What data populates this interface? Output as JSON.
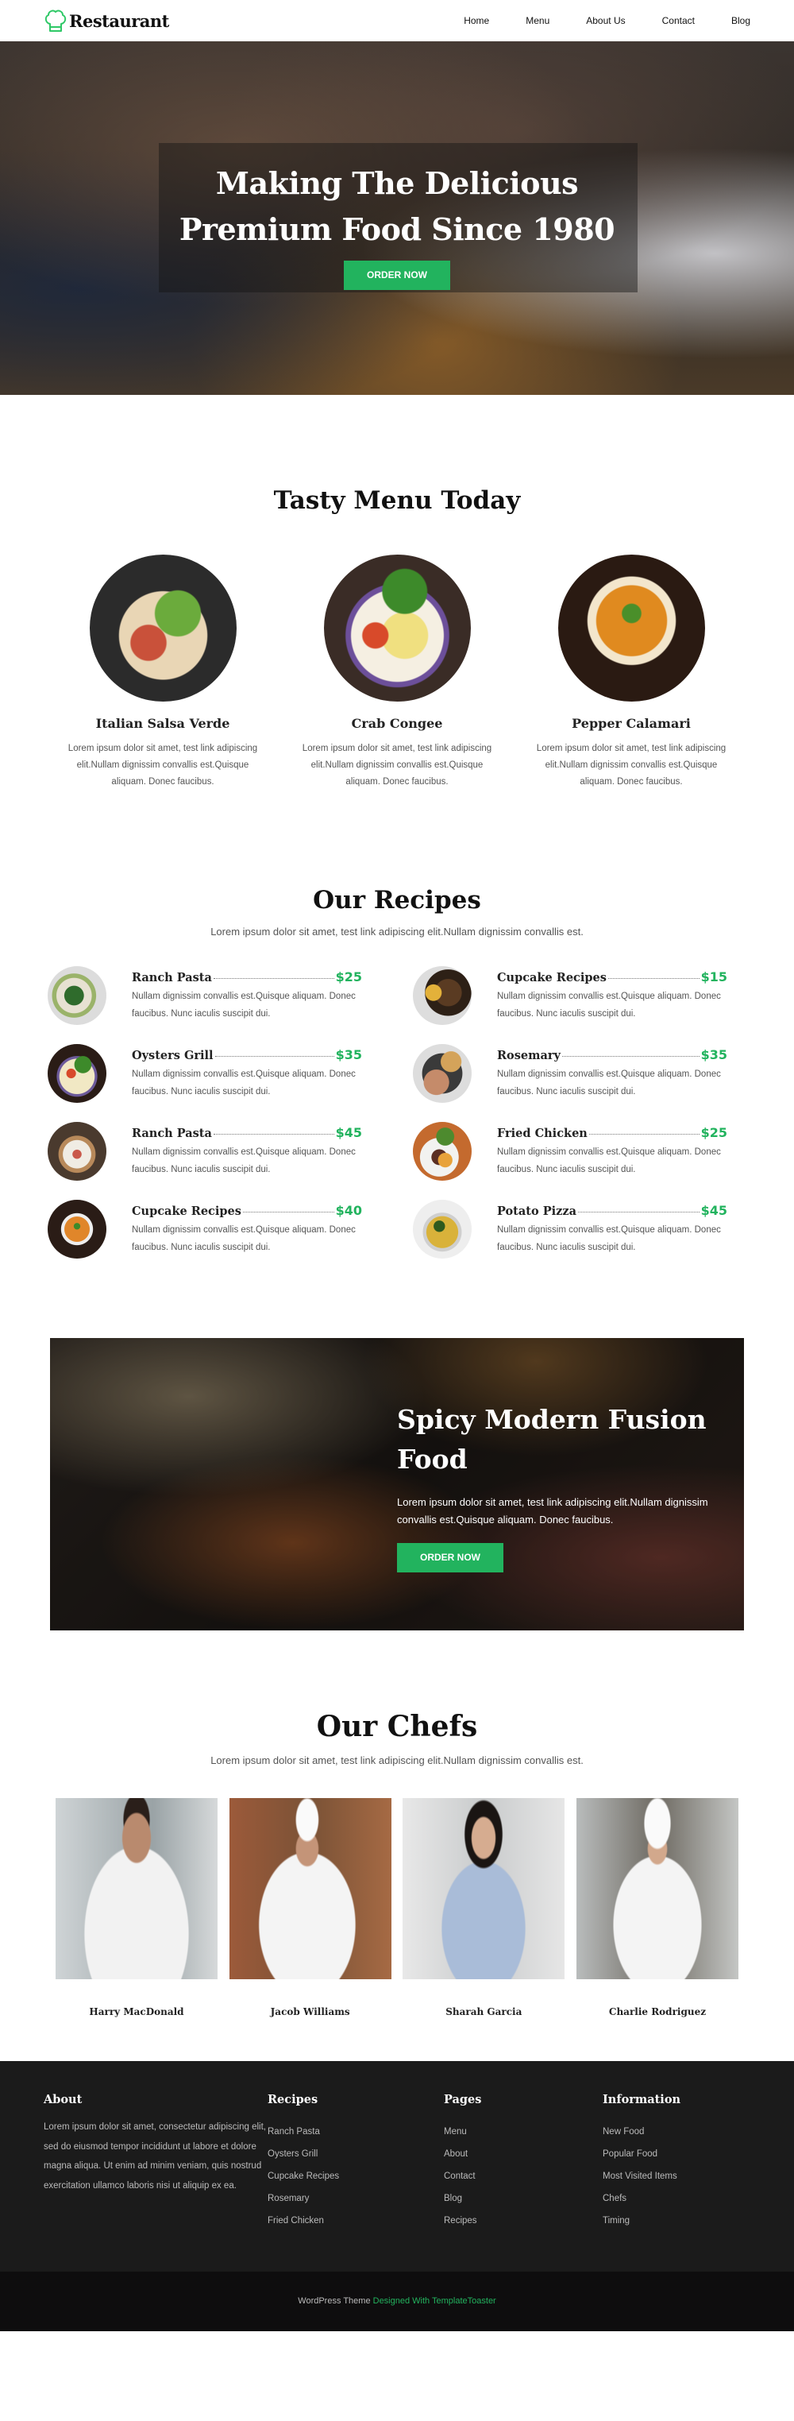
{
  "header": {
    "logo_text": "Restaurant",
    "logo_icon": "chef-hat-icon",
    "nav": [
      "Home",
      "Menu",
      "About Us",
      "Contact",
      "Blog"
    ]
  },
  "hero": {
    "title_line1": "Making The Delicious",
    "title_line2": "Premium Food Since 1980",
    "button": "ORDER NOW"
  },
  "tasty_menu": {
    "title": "Tasty Menu Today",
    "items": [
      {
        "name": "Italian Salsa Verde",
        "desc": "Lorem ipsum dolor sit amet, test link adipiscing elit.Nullam dignissim convallis est.Quisque aliquam. Donec faucibus."
      },
      {
        "name": "Crab Congee",
        "desc": "Lorem ipsum dolor sit amet, test link adipiscing elit.Nullam dignissim convallis est.Quisque aliquam. Donec faucibus."
      },
      {
        "name": "Pepper Calamari",
        "desc": "Lorem ipsum dolor sit amet, test link adipiscing elit.Nullam dignissim convallis est.Quisque aliquam. Donec faucibus."
      }
    ]
  },
  "recipes": {
    "title": "Our Recipes",
    "subtitle": "Lorem ipsum dolor sit amet, test link adipiscing elit.Nullam dignissim convallis est.",
    "items": [
      {
        "name": "Ranch Pasta",
        "price": "$25",
        "desc": "Nullam dignissim convallis est.Quisque aliquam. Donec faucibus. Nunc iaculis suscipit dui."
      },
      {
        "name": "Cupcake Recipes",
        "price": "$15",
        "desc": "Nullam dignissim convallis est.Quisque aliquam. Donec faucibus. Nunc iaculis suscipit dui."
      },
      {
        "name": "Oysters Grill",
        "price": "$35",
        "desc": "Nullam dignissim convallis est.Quisque aliquam. Donec faucibus. Nunc iaculis suscipit dui."
      },
      {
        "name": "Rosemary",
        "price": "$35",
        "desc": "Nullam dignissim convallis est.Quisque aliquam. Donec faucibus. Nunc iaculis suscipit dui."
      },
      {
        "name": "Ranch Pasta",
        "price": "$45",
        "desc": "Nullam dignissim convallis est.Quisque aliquam. Donec faucibus. Nunc iaculis suscipit dui."
      },
      {
        "name": "Fried Chicken",
        "price": "$25",
        "desc": "Nullam dignissim convallis est.Quisque aliquam. Donec faucibus. Nunc iaculis suscipit dui."
      },
      {
        "name": "Cupcake Recipes",
        "price": "$40",
        "desc": "Nullam dignissim convallis est.Quisque aliquam. Donec faucibus. Nunc iaculis suscipit dui."
      },
      {
        "name": "Potato Pizza",
        "price": "$45",
        "desc": "Nullam dignissim convallis est.Quisque aliquam. Donec faucibus. Nunc iaculis suscipit dui."
      }
    ]
  },
  "banner": {
    "title": "Spicy Modern Fusion Food",
    "text": "Lorem ipsum dolor sit amet, test link adipiscing elit.Nullam dignissim convallis est.Quisque aliquam. Donec faucibus.",
    "button": "ORDER NOW"
  },
  "chefs": {
    "title": "Our Chefs",
    "subtitle": "Lorem ipsum dolor sit amet, test link adipiscing elit.Nullam dignissim convallis est.",
    "items": [
      {
        "name": "Harry MacDonald"
      },
      {
        "name": "Jacob Williams"
      },
      {
        "name": "Sharah Garcia"
      },
      {
        "name": "Charlie Rodriguez"
      }
    ]
  },
  "footer": {
    "about": {
      "title": "About",
      "text": "Lorem ipsum dolor sit amet, consectetur adipiscing elit, sed do eiusmod tempor incididunt ut labore et dolore magna aliqua. Ut enim ad minim veniam, quis nostrud exercitation ullamco laboris nisi ut aliquip ex ea."
    },
    "recipes": {
      "title": "Recipes",
      "links": [
        "Ranch Pasta",
        "Oysters Grill",
        "Cupcake Recipes",
        "Rosemary",
        "Fried Chicken"
      ]
    },
    "pages": {
      "title": "Pages",
      "links": [
        "Menu",
        "About",
        "Contact",
        "Blog",
        "Recipes"
      ]
    },
    "information": {
      "title": "Information",
      "links": [
        "New Food",
        "Popular Food",
        "Most Visited Items",
        "Chefs",
        "Timing"
      ]
    }
  },
  "copyright": {
    "prefix": "WordPress Theme",
    "link": "Designed With TemplateToaster"
  },
  "colors": {
    "accent": "#22b35e",
    "footer_bg": "#1b1b1b",
    "copyright_bg": "#0e0d0e"
  }
}
